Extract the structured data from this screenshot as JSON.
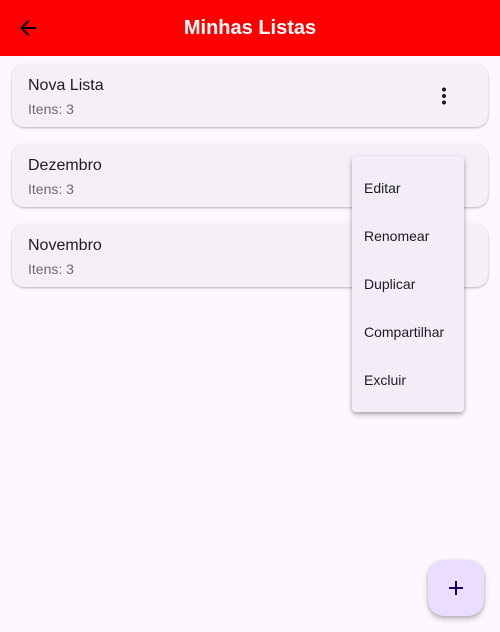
{
  "app_bar": {
    "title": "Minhas Listas",
    "background_color": "#ff0000",
    "back_icon": "arrow-left-icon"
  },
  "lists": [
    {
      "title": "Nova Lista",
      "subtitle": "Itens: 3"
    },
    {
      "title": "Dezembro",
      "subtitle": "Itens: 3"
    },
    {
      "title": "Novembro",
      "subtitle": "Itens: 3"
    }
  ],
  "menu": {
    "items": [
      "Editar",
      "Renomear",
      "Duplicar",
      "Compartilhar",
      "Excluir"
    ]
  },
  "more_icon": "more-vertical-icon",
  "fab": {
    "icon": "plus-icon",
    "background_color": "#eaddff"
  }
}
